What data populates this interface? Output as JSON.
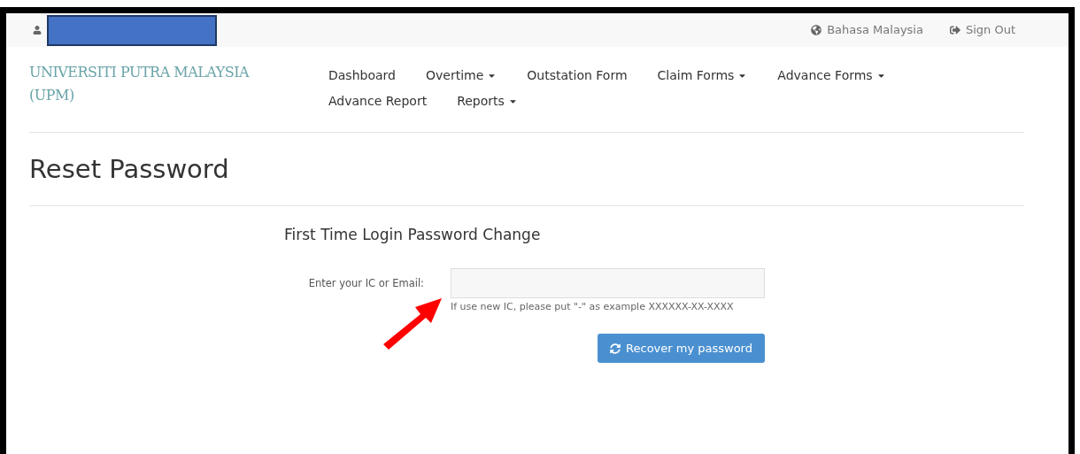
{
  "top_bar": {
    "language": "Bahasa Malaysia",
    "sign_out": "Sign Out"
  },
  "brand": "UNIVERSITI PUTRA MALAYSIA (UPM)",
  "nav": [
    {
      "label": "Dashboard",
      "dropdown": false
    },
    {
      "label": "Overtime",
      "dropdown": true
    },
    {
      "label": "Outstation Form",
      "dropdown": false
    },
    {
      "label": "Claim Forms",
      "dropdown": true
    },
    {
      "label": "Advance Forms",
      "dropdown": true
    },
    {
      "label": "Advance Report",
      "dropdown": false
    },
    {
      "label": "Reports",
      "dropdown": true
    }
  ],
  "page_title": "Reset Password",
  "form": {
    "heading": "First Time Login Password Change",
    "label": "Enter your IC or Email:",
    "help": "If use new IC, please put \"-\" as example XXXXXX-XX-XXXX",
    "button": "Recover my password"
  }
}
